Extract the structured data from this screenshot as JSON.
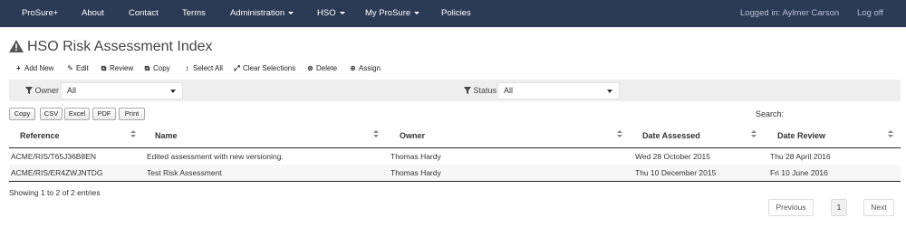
{
  "navbar": {
    "items": [
      {
        "label": "ProSure+",
        "caret": false
      },
      {
        "label": "About",
        "caret": false
      },
      {
        "label": "Contact",
        "caret": false
      },
      {
        "label": "Terms",
        "caret": false
      },
      {
        "label": "Administration",
        "caret": true
      },
      {
        "label": "HSO",
        "caret": true
      },
      {
        "label": "My ProSure",
        "caret": true
      },
      {
        "label": "Policies",
        "caret": false
      }
    ],
    "logged_in": "Logged in: Aylmer Carson",
    "logout": "Log off"
  },
  "page": {
    "title": "HSO Risk Assessment Index",
    "title_icon": "warning-icon"
  },
  "toolbar": {
    "items": [
      {
        "label": "Add New",
        "icon": "plus-icon",
        "glyph": "+"
      },
      {
        "label": "Edit",
        "icon": "edit-icon",
        "glyph": "✎"
      },
      {
        "label": "Review",
        "icon": "copy-icon",
        "glyph": "⧉"
      },
      {
        "label": "Copy",
        "icon": "copy-icon",
        "glyph": "⧉"
      },
      {
        "label": "Select All",
        "icon": "sort-icon",
        "glyph": "↕"
      },
      {
        "label": "Clear Selections",
        "icon": "resize-icon",
        "glyph": "⤢"
      },
      {
        "label": "Delete",
        "icon": "remove-circle-icon",
        "glyph": "⊗"
      },
      {
        "label": "Assign",
        "icon": "assign-icon",
        "glyph": "⊕"
      }
    ]
  },
  "filters": {
    "owner": {
      "label": "Owner",
      "value": "All"
    },
    "status": {
      "label": "Status",
      "value": "All"
    }
  },
  "export_buttons": [
    "Copy",
    "CSV",
    "Excel",
    "PDF",
    "Print"
  ],
  "search": {
    "label": "Search:"
  },
  "table": {
    "columns": [
      "Reference",
      "Name",
      "Owner",
      "Date Assessed",
      "Date Review"
    ],
    "rows": [
      [
        "ACME/RIS/T65J36B8EN",
        "Edited assessment with new versioning.",
        "Thomas Hardy",
        "Wed 28 October 2015",
        "Thu 28 April 2016"
      ],
      [
        "ACME/RIS/ER4ZWJNTDG",
        "Test Risk Assessment",
        "Thomas Hardy",
        "Thu 10 December 2015",
        "Fri 10 June 2016"
      ]
    ]
  },
  "info": "Showing 1 to 2 of 2 entries",
  "pagination": {
    "previous": "Previous",
    "current": "1",
    "next": "Next"
  }
}
